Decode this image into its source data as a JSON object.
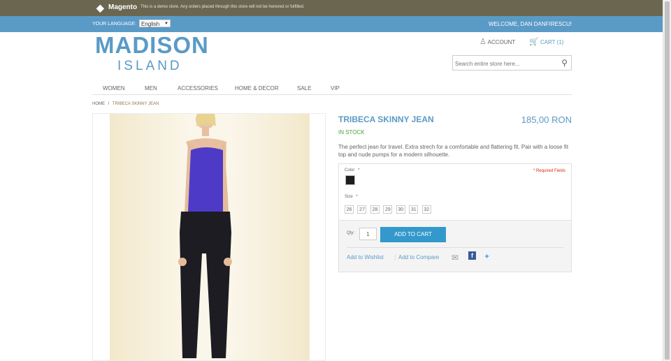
{
  "topbar": {
    "brand": "Magento",
    "notice": "This is a demo store. Any orders placed through this store will not be honored or fulfilled."
  },
  "langbar": {
    "label": "YOUR LANGUAGE:",
    "language": "English",
    "welcome": "WELCOME, DAN DANFIRESCU!"
  },
  "logo": {
    "line1": "MADISON",
    "line2": "ISLAND"
  },
  "header": {
    "account": "ACCOUNT",
    "cart": "CART (1)",
    "search_placeholder": "Search entire store here..."
  },
  "nav": [
    "WOMEN",
    "MEN",
    "ACCESSORIES",
    "HOME & DECOR",
    "SALE",
    "VIP"
  ],
  "breadcrumb": {
    "home": "HOME",
    "sep": "/",
    "current": "TRIBECA SKINNY JEAN"
  },
  "product": {
    "name": "TRIBECA SKINNY JEAN",
    "price": "185,00 RON",
    "availability": "IN STOCK",
    "description": "The perfect jean for travel. Extra strech for a comfortable and flattering fit. Pair with a loose fit top and nude pumps for a modern silhouette.",
    "color_label": "Color",
    "required_mark": "*",
    "required_note": "* Required Fields",
    "size_label": "Size",
    "sizes": [
      "26",
      "27",
      "28",
      "29",
      "30",
      "31",
      "32"
    ],
    "qty_label": "Qty:",
    "qty": "1",
    "add_to_cart": "ADD TO CART",
    "wishlist": "Add to Wishlist",
    "compare": "Add to Compare"
  },
  "colors": {
    "accent": "#5a9ac6",
    "button": "#3399cc",
    "instock": "#48a339",
    "topbar": "#6b6650",
    "swatch": "#1e1e1e"
  }
}
